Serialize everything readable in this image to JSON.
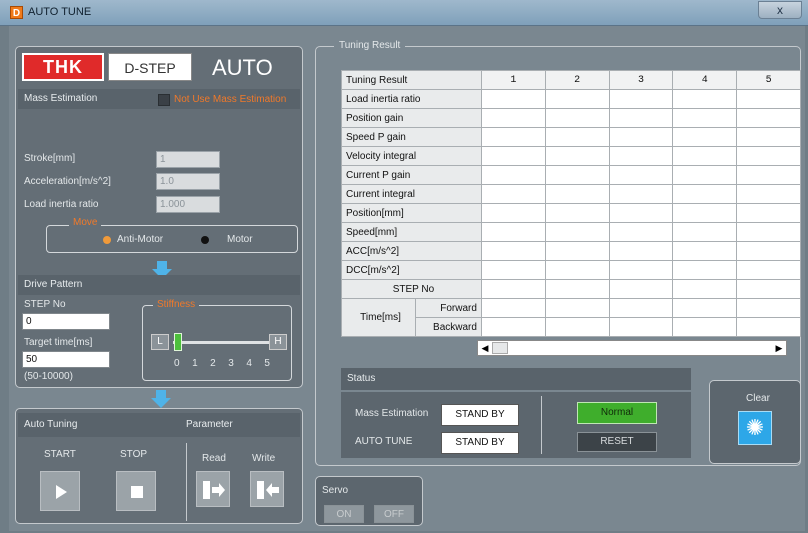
{
  "window": {
    "title": "AUTO TUNE",
    "app_icon_letter": "D",
    "close_label": "x"
  },
  "header": {
    "logo_text": "THK",
    "product": "D-STEP",
    "mode": "AUTO"
  },
  "mass_estimation": {
    "section": "Mass Estimation",
    "toggle_label": "Not Use Mass Estimation",
    "stroke_label": "Stroke[mm]",
    "stroke_value": "1",
    "accel_label": "Acceleration[m/s^2]",
    "accel_value": "1.0",
    "inertia_label": "Load inertia ratio",
    "inertia_value": "1.000",
    "move_title": "Move",
    "move_options": [
      "Anti-Motor",
      "Motor"
    ],
    "move_selected": "Anti-Motor"
  },
  "drive_pattern": {
    "section": "Drive Pattern",
    "step_label": "STEP No",
    "step_value": "0",
    "target_label": "Target time[ms]",
    "target_value": "50",
    "target_range": "(50-10000)",
    "stiffness_title": "Stiffness",
    "stiffness_low": "L",
    "stiffness_high": "H",
    "stiffness_ticks": [
      "0",
      "1",
      "2",
      "3",
      "4",
      "5"
    ],
    "stiffness_value": 0
  },
  "auto_tuning": {
    "section": "Auto Tuning",
    "parameter": "Parameter",
    "start": "START",
    "stop": "STOP",
    "read": "Read",
    "write": "Write"
  },
  "servo": {
    "title": "Servo",
    "on": "ON",
    "off": "OFF"
  },
  "tuning_result": {
    "title": "Tuning Result",
    "corner": "Tuning Result",
    "columns": [
      "1",
      "2",
      "3",
      "4",
      "5"
    ],
    "rows": [
      "Load inertia ratio",
      "Position gain",
      "Speed P gain",
      "Velocity integral",
      "Current P gain",
      "Current integral",
      "Position[mm]",
      "Speed[mm]",
      "ACC[m/s^2]",
      "DCC[m/s^2]"
    ],
    "step_no": "STEP No",
    "time_label": "Time[ms]",
    "forward": "Forward",
    "backward": "Backward"
  },
  "status": {
    "title": "Status",
    "mass_label": "Mass Estimation",
    "mass_value": "STAND BY",
    "auto_label": "AUTO TUNE",
    "auto_value": "STAND BY",
    "normal": "Normal",
    "reset": "RESET"
  },
  "clear": {
    "label": "Clear",
    "icon": "burst-icon"
  },
  "colors": {
    "accent_red": "#e02a2a",
    "status_green": "#3fae2c",
    "arrow_blue": "#4fb3e8",
    "warning_orange": "#f07a1a"
  }
}
